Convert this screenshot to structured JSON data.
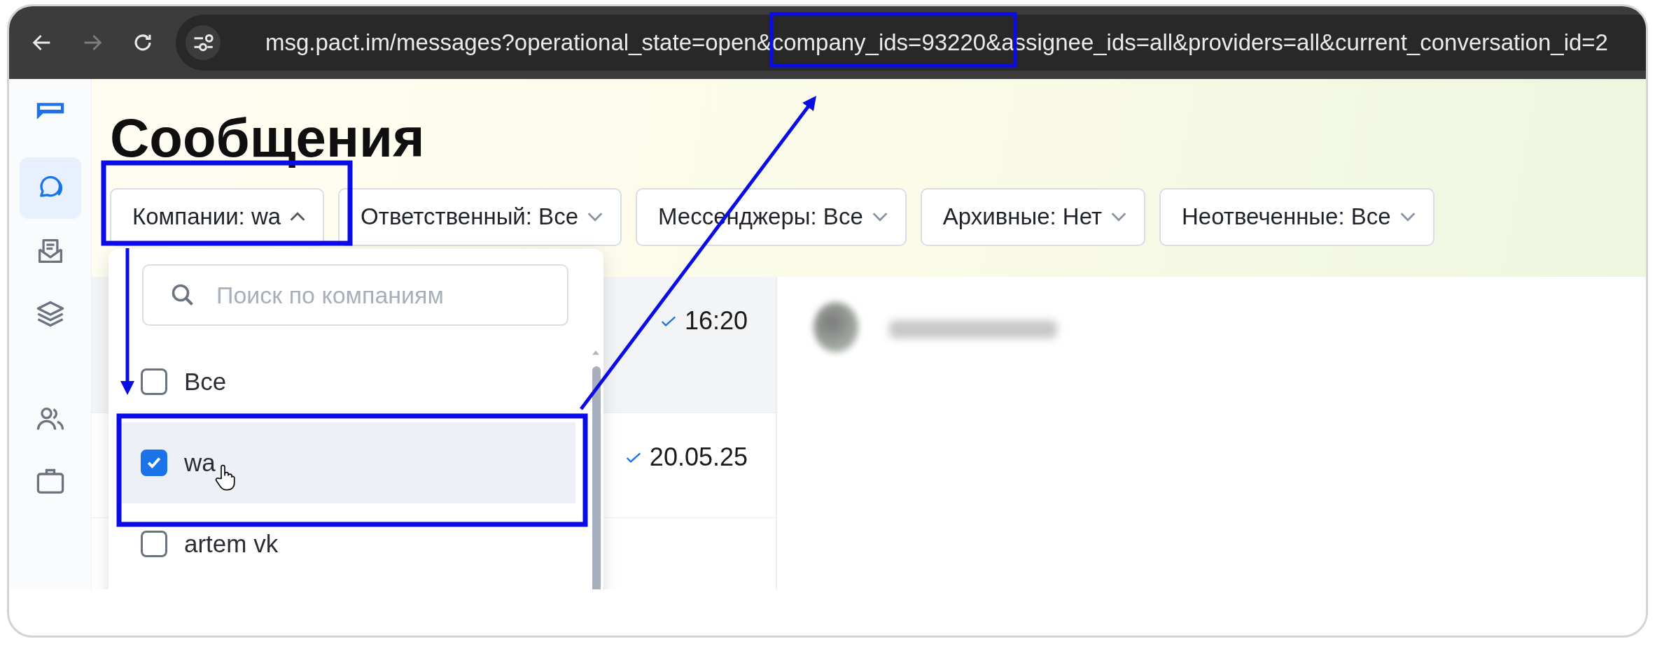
{
  "browser": {
    "url": "msg.pact.im/messages?operational_state=open&company_ids=93220&assignee_ids=all&providers=all&current_conversation_id=2"
  },
  "sidebar": {
    "items": [
      {
        "kind": "chat",
        "selected": true
      },
      {
        "kind": "inbox",
        "selected": false
      },
      {
        "kind": "layers",
        "selected": false
      },
      {
        "kind": "people",
        "selected": false
      },
      {
        "kind": "card",
        "selected": false
      }
    ]
  },
  "page": {
    "title": "Сообщения"
  },
  "filters": [
    {
      "label": "Компании: wa",
      "expanded": true
    },
    {
      "label": "Ответственный: Все",
      "expanded": false
    },
    {
      "label": "Мессенджеры: Все",
      "expanded": false
    },
    {
      "label": "Архивные: Нет",
      "expanded": false
    },
    {
      "label": "Неотвеченные: Все",
      "expanded": false
    }
  ],
  "dropdown": {
    "search": {
      "placeholder": "Поиск по компаниям"
    },
    "options": [
      {
        "label": "Все",
        "checked": false,
        "hovered": false
      },
      {
        "label": "wa",
        "checked": true,
        "hovered": true
      },
      {
        "label": "artem vk",
        "checked": false,
        "hovered": false
      }
    ]
  },
  "conversations": [
    {
      "time": "16:20",
      "selected": true
    },
    {
      "time": "20.05.25",
      "selected": false
    }
  ]
}
